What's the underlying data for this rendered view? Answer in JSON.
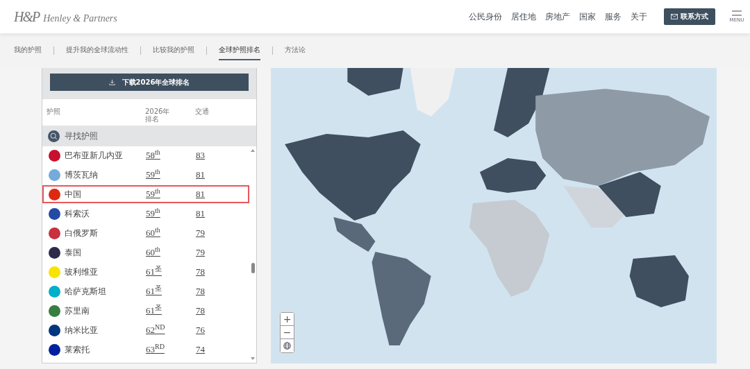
{
  "header": {
    "logo_mark": "H&P",
    "logo_text": "Henley & Partners",
    "nav": [
      "公民身份",
      "居住地",
      "房地产",
      "国家",
      "服务",
      "关于"
    ],
    "contact_button": "联系方式",
    "menu_label": "MENU"
  },
  "subnav": [
    {
      "label": "我的护照",
      "selected": false
    },
    {
      "label": "提升我的全球流动性",
      "selected": false
    },
    {
      "label": "比较我的护照",
      "selected": false
    },
    {
      "label": "全球护照排名",
      "selected": true
    },
    {
      "label": "方法论",
      "selected": false
    }
  ],
  "ranking": {
    "download_button": "下载2026年全球排名",
    "columns": [
      "护照",
      "2026年排名",
      "交通"
    ],
    "search_placeholder": "寻找护照",
    "rows": [
      {
        "country": "巴布亚新几内亚",
        "rank": "58$^{th}$",
        "score": "83",
        "color": "#c8102e",
        "selected": false
      },
      {
        "country": "博茨瓦纳",
        "rank": "59$^{th}$",
        "score": "81",
        "color": "#75aadb",
        "selected": false
      },
      {
        "country": "中国",
        "rank": "59$^{th}$",
        "score": "81",
        "color": "#de2910",
        "selected": true
      },
      {
        "country": "科索沃",
        "rank": "59$^{th}$",
        "score": "81",
        "color": "#244aa5",
        "selected": false
      },
      {
        "country": "白俄罗斯",
        "rank": "60$^{th}$",
        "score": "79",
        "color": "#c8313e",
        "selected": false
      },
      {
        "country": "泰国",
        "rank": "60$^{th}$",
        "score": "79",
        "color": "#2d2a4a",
        "selected": false
      },
      {
        "country": "玻利维亚",
        "rank": "61$^{圣}$",
        "score": "78",
        "color": "#f9e300",
        "selected": false
      },
      {
        "country": "哈萨克斯坦",
        "rank": "61$^{圣}$",
        "score": "78",
        "color": "#00afca",
        "selected": false
      },
      {
        "country": "苏里南",
        "rank": "61$^{圣}$",
        "score": "78",
        "color": "#377e3f",
        "selected": false
      },
      {
        "country": "纳米比亚",
        "rank": "62$^{ND}$",
        "score": "76",
        "color": "#003580",
        "selected": false
      },
      {
        "country": "莱索托",
        "rank": "63$^{RD}$",
        "score": "74",
        "color": "#00209f",
        "selected": false
      }
    ]
  },
  "map": {
    "zoom_in": "+",
    "zoom_out": "−"
  }
}
